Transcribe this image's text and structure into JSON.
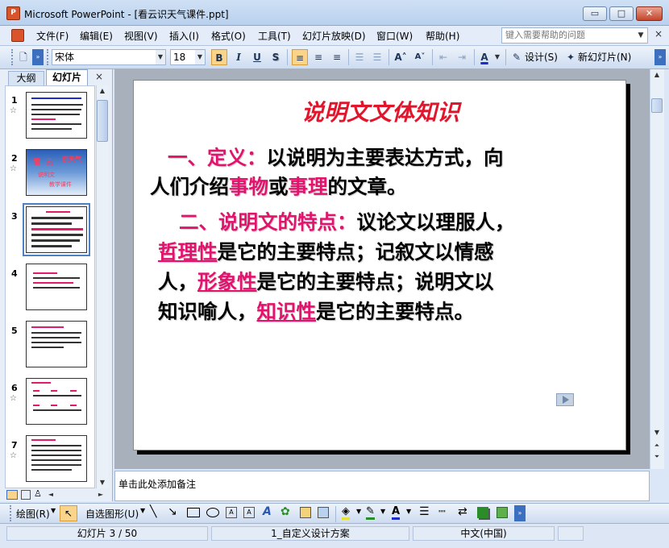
{
  "window": {
    "title": "Microsoft PowerPoint - [看云识天气课件.ppt]",
    "app_icon_label": "P",
    "controls": {
      "minimize": "▭",
      "maximize": "□",
      "close": "✕"
    }
  },
  "menu": {
    "items": [
      "文件(F)",
      "编辑(E)",
      "视图(V)",
      "插入(I)",
      "格式(O)",
      "工具(T)",
      "幻灯片放映(D)",
      "窗口(W)",
      "帮助(H)"
    ],
    "help_placeholder": "键入需要帮助的问题",
    "close_glyph": "×"
  },
  "toolbar": {
    "font_name": "宋体",
    "font_size": "18",
    "bold": "B",
    "italic": "I",
    "underline": "U",
    "shadow": "S",
    "grow_font": "A˄",
    "shrink_font": "A˅",
    "font_color": "A",
    "design_label": "设计(S)",
    "new_slide_label": "新幻灯片(N)"
  },
  "left_pane": {
    "tabs": [
      {
        "label": "大纲"
      },
      {
        "label": "幻灯片"
      }
    ],
    "close_glyph": "×",
    "slides": [
      {
        "num": "1"
      },
      {
        "num": "2"
      },
      {
        "num": "3"
      },
      {
        "num": "4"
      },
      {
        "num": "5"
      },
      {
        "num": "6"
      },
      {
        "num": "7"
      }
    ],
    "star": "☆",
    "thumb2_text": {
      "a": "看",
      "b": "云",
      "c": "识天气",
      "d": "说明文",
      "e": "教学课件"
    }
  },
  "slide": {
    "title": "说明文文体知识",
    "p1": {
      "lead": "一、定义：",
      "line1_rest": "以说明为主要表达方式，向",
      "line2_a": "人们介绍",
      "line2_pink1": "事物",
      "line2_b": "或",
      "line2_pink2": "事理",
      "line2_c": "的文章。"
    },
    "p2": {
      "lead": "二、说明文的特点：",
      "line1_rest": "议论文以理服人，",
      "term1": "哲理性",
      "line2_rest": "是它的主要特点；记叙文以情感",
      "line3_a": "人，",
      "term2": "形象性",
      "line3_rest": "是它的主要特点；说明文以",
      "line4_a": "知识喻人，",
      "term3": "知识性",
      "line4_rest": "是它的主要特点。"
    }
  },
  "notes": {
    "placeholder": "单击此处添加备注"
  },
  "drawing_toolbar": {
    "draw_label": "绘图(R)",
    "autoshapes_label": "自选图形(U)"
  },
  "status": {
    "slide_pos": "幻灯片 3 / 50",
    "design": "1_自定义设计方案",
    "language": "中文(中国)"
  },
  "colors": {
    "accent_pink": "#e3126d",
    "title_red": "#e0172c",
    "chrome_blue": "#dbe7f6"
  }
}
